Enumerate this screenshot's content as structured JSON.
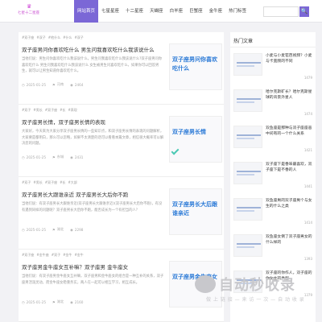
{
  "header": {
    "logo_text": "七星十二星座",
    "nav": [
      "网站首页",
      "七星星座",
      "十二星座",
      "天蝎座",
      "白羊座",
      "巨蟹座",
      "金牛座",
      "热门标签"
    ],
    "search_button": "🔍"
  },
  "posts": [
    {
      "tags": [
        "#双子座",
        "#双子",
        "#他什么",
        "#什么",
        "#双子"
      ],
      "title": "双子座男问你喜欢吃什么 男生问我喜欢吃什么我该说什么",
      "excerpt": "当他们说：男生问你喜欢吃什么我该说什么，男生问我喜欢吃什么我该说什么?双子座男问你喜欢吃什么 男生问我喜欢吃什么我该说什么 女生被男生问喜欢吃什么，如果你可以回答男生，就可以让男生知道你喜欢吃什么。",
      "date": "2025-01-25",
      "author": "河南",
      "views": "2464",
      "thumb": "双子座男问你喜欢吃什么"
    },
    {
      "tags": [
        "#双子",
        "#男长",
        "#双子座",
        "#长",
        "#表现"
      ],
      "title": "双子座男长情，双子座男长情的表现",
      "excerpt": "大家好，今天来为大家分享双子座男长情的一些知识点，和双子座男长情的表现的问题解析，大家要是都明白，那么可以忽略，如果不太清楚的话可以看看本篇文章，相信很大概率可以解决您的问题。",
      "date": "2025-01-25",
      "author": "东城",
      "views": "2431",
      "thumb": "双子座男长情"
    },
    {
      "tags": [
        "#双子",
        "#男长",
        "#双子座",
        "#长",
        "#大部"
      ],
      "title": "双子座男长大跟谁亲近 双子座男长大后你不跑",
      "excerpt": "当他们说：有双子座男长大跟谁亲近(双子座男长大跟谁亲近)(双子座男长大后你不跑)，有没有遇到同样的问题呢？双子座男长大后你不跑，能否成长为一个有担当的人？",
      "date": "2025-01-25",
      "author": "湖北",
      "views": "2298",
      "thumb": "双子座男长大后跟谁亲近"
    },
    {
      "tags": [
        "#双子座",
        "#金牛座",
        "#双子",
        "#金牛",
        "#金牛"
      ],
      "title": "双子座男金牛座女互补嘛？双子座男 金牛座女",
      "excerpt": "当他们说：有双子座男金牛座女互补嘛，双子座男和金牛座女的组合是一种互补的关系，双子座男活泼灵动，而金牛座女稳重务实，两人在一起可以相互学习，相互成长。",
      "date": "2025-01-25",
      "author": "湖北",
      "views": "2160",
      "thumb": "双子座男金牛座女"
    }
  ],
  "sidebar": {
    "title": "热门文章",
    "items": [
      {
        "text": "小麦与小麦苞芭视频？小麦与卡宽频的不同",
        "count": "1479"
      },
      {
        "text": "哈尔克斯矿长？哈尔克斯星球的背景外星人",
        "count": "1474"
      },
      {
        "text": "双鱼座是那种与双子座座恶中间有的一个什么关系",
        "count": "1421"
      },
      {
        "text": "双子座下是香味最喜欢，双子座下是不香的人",
        "count": "1441"
      },
      {
        "text": "双鱼座男的双子座男个与女生的什么之类",
        "count": "1414"
      },
      {
        "text": "双鱼座女倒了双子座男女的什么样的",
        "count": "1393"
      },
      {
        "text": "双子座的你作人，双子座的你女主的类型",
        "count": "1379"
      }
    ]
  },
  "watermark": {
    "title": "自动秒收录",
    "subtitle": "做 上 链 接 — 来 访 一 次 — 自 动 收 录"
  }
}
